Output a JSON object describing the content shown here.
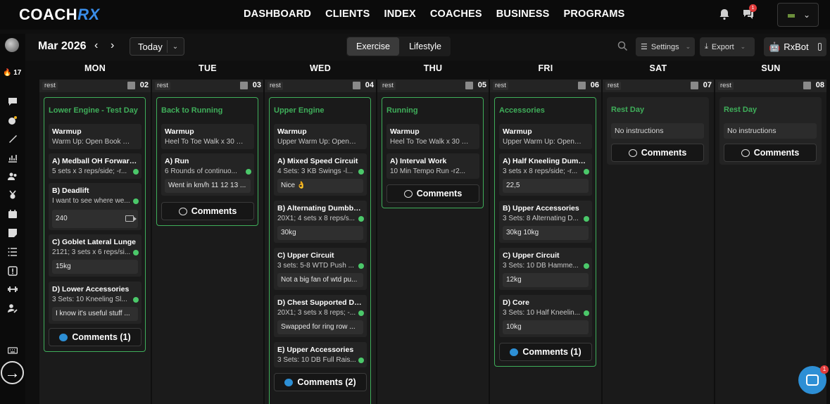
{
  "app": {
    "logo_main": "COACH",
    "logo_accent": "RX",
    "nav": [
      "DASHBOARD",
      "CLIENTS",
      "INDEX",
      "COACHES",
      "BUSINESS",
      "PROGRAMS"
    ],
    "notification_count": "1",
    "streak": "17"
  },
  "toolbar": {
    "month": "Mar 2026",
    "today_label": "Today",
    "view_exercise": "Exercise",
    "view_lifestyle": "Lifestyle",
    "settings_label": "Settings",
    "export_label": "Export",
    "rxbot_label": "RxBot"
  },
  "days": [
    {
      "name": "MON",
      "num": "02",
      "tag": "rest"
    },
    {
      "name": "TUE",
      "num": "03",
      "tag": "rest"
    },
    {
      "name": "WED",
      "num": "04",
      "tag": "rest"
    },
    {
      "name": "THU",
      "num": "05",
      "tag": "rest"
    },
    {
      "name": "FRI",
      "num": "06",
      "tag": "rest"
    },
    {
      "name": "SAT",
      "num": "07",
      "tag": "rest"
    },
    {
      "name": "SUN",
      "num": "08",
      "tag": "rest"
    }
  ],
  "workouts": {
    "mon": {
      "title": "Lower Engine - Test Day",
      "items": [
        {
          "name": "Warmup",
          "desc": "Warm Up: Open Book St..."
        },
        {
          "name": "A) Medball OH Forward...",
          "desc": "5 sets x 3 reps/side; -r..."
        },
        {
          "name": "B) Deadlift",
          "desc": "I want to see where we...",
          "result": "240"
        },
        {
          "name": "C) Goblet Lateral Lunge",
          "desc": "2121; 3 sets x 6 reps/si...",
          "result": "15kg"
        },
        {
          "name": "D) Lower Accessories",
          "desc": "3 Sets: 10 Kneeling Sl...",
          "result": "I know it's useful stuff ..."
        }
      ],
      "comments": "Comments (1)"
    },
    "tue": {
      "title": "Back to Running",
      "items": [
        {
          "name": "Warmup",
          "desc": "Heel To Toe Walk x 30 H..."
        },
        {
          "name": "A) Run",
          "desc": "6 Rounds of continuo...",
          "result": "Went in km/h 11 12 13 ..."
        }
      ],
      "comments": "Comments"
    },
    "wed": {
      "title": "Upper Engine",
      "items": [
        {
          "name": "Warmup",
          "desc": "Upper Warm Up: Open ..."
        },
        {
          "name": "A) Mixed Speed Circuit",
          "desc": "4 Sets: 3 KB Swings -l...",
          "result": "Nice 👌"
        },
        {
          "name": "B) Alternating Dumbbel...",
          "desc": "20X1; 4 sets x 8 reps/s...",
          "result": "30kg"
        },
        {
          "name": "C) Upper Circuit",
          "desc": "3 sets: 5-8 WTD Push ...",
          "result": "Not a big fan of wtd pu..."
        },
        {
          "name": "D) Chest Supported Du...",
          "desc": "20X1; 3 sets x 8 reps; -...",
          "result": "Swapped for ring row ..."
        },
        {
          "name": "E) Upper Accessories",
          "desc": "3 Sets: 10 DB Full Rais..."
        }
      ],
      "comments": "Comments (2)"
    },
    "thu": {
      "title": "Running",
      "items": [
        {
          "name": "Warmup",
          "desc": "Heel To Toe Walk x 30 H..."
        },
        {
          "name": "A) Interval Work",
          "desc": "10 Min Tempo Run -r2..."
        }
      ],
      "comments": "Comments"
    },
    "fri": {
      "title": "Accessories",
      "items": [
        {
          "name": "Warmup",
          "desc": "Upper Warm Up: Open ..."
        },
        {
          "name": "A) Half Kneeling Dumb...",
          "desc": "3 sets x 8 reps/side; -r...",
          "result": "22,5"
        },
        {
          "name": "B) Upper Accessories",
          "desc": "3 Sets: 8 Alternating D...",
          "result": "30kg 10kg"
        },
        {
          "name": "C) Upper Circuit",
          "desc": "3 Sets: 10 DB Hamme...",
          "result": "12kg"
        },
        {
          "name": "D) Core",
          "desc": "3 Sets: 10 Half Kneelin...",
          "result": "10kg"
        }
      ],
      "comments": "Comments (1)"
    },
    "sat": {
      "title": "Rest Day",
      "note": "No instructions",
      "comments": "Comments"
    },
    "sun": {
      "title": "Rest Day",
      "note": "No instructions",
      "comments": "Comments"
    }
  },
  "support_badge": "1"
}
